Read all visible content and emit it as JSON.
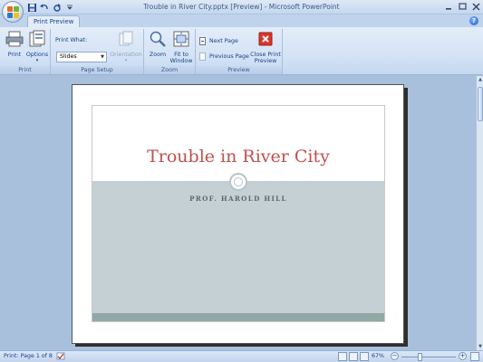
{
  "window": {
    "title": "Trouble in River City.pptx [Preview] - Microsoft PowerPoint"
  },
  "tabs": {
    "active": "Print Preview"
  },
  "ribbon": {
    "print_group": {
      "print_label": "Print",
      "options_label": "Options",
      "group_label": "Print"
    },
    "page_setup_group": {
      "print_what_label": "Print What:",
      "print_what_value": "Slides",
      "orientation_label": "Orientation",
      "group_label": "Page Setup"
    },
    "zoom_group": {
      "zoom_label": "Zoom",
      "fit_label_1": "Fit to",
      "fit_label_2": "Window",
      "group_label": "Zoom"
    },
    "preview_group": {
      "next_label": "Next Page",
      "prev_label": "Previous Page",
      "close_label_1": "Close Print",
      "close_label_2": "Preview",
      "group_label": "Preview"
    }
  },
  "slide": {
    "title": "Trouble in River City",
    "subtitle": "PROF. HAROLD HILL",
    "title_color": "#c0504d",
    "body_color": "#c5d0d5",
    "band_color": "#8fa9a6"
  },
  "status": {
    "page_text": "Print: Page 1 of 8",
    "zoom_level": "67%"
  },
  "icons": [
    "office-button-icon",
    "save-icon",
    "undo-icon",
    "redo-icon",
    "help-icon",
    "print-icon",
    "options-icon",
    "orientation-icon",
    "zoom-icon",
    "fit-window-icon",
    "next-page-icon",
    "previous-page-icon",
    "close-preview-icon",
    "spelling-icon"
  ]
}
